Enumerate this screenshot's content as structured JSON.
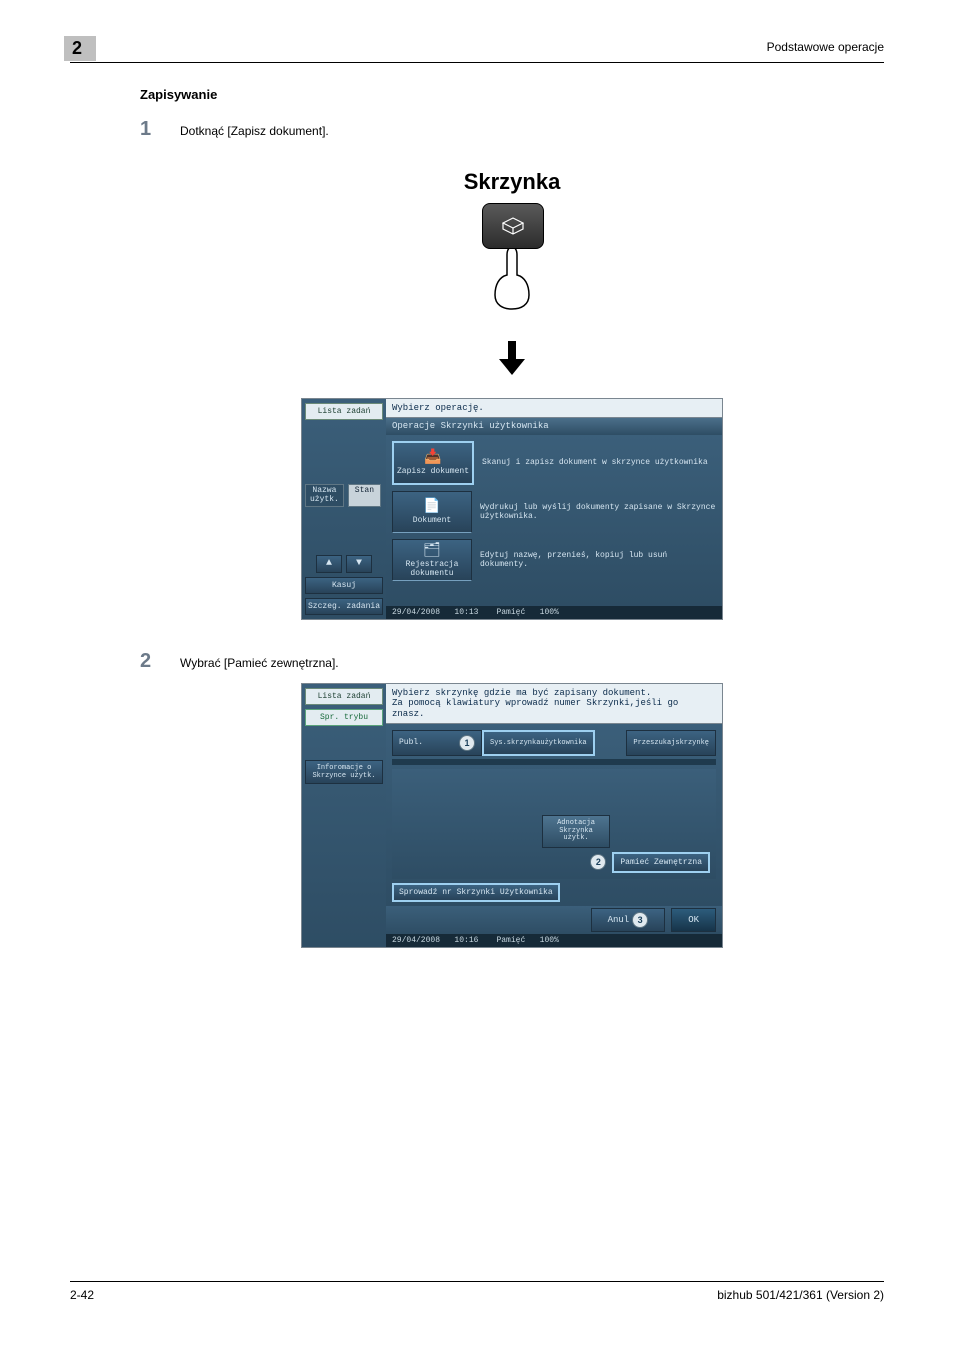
{
  "header": {
    "chapter": "2",
    "right": "Podstawowe operacje"
  },
  "section_title": "Zapisywanie",
  "step1": {
    "num": "1",
    "text": "Dotknąć [Zapisz dokument]."
  },
  "big_title": "Skrzynka",
  "screen1": {
    "side": {
      "list_tasks": "Lista zadań",
      "tab_name": "Nazwa użytk.",
      "tab_status": "Stan",
      "delete": "Kasuj",
      "details": "Szczeg. zadania"
    },
    "top": "Wybierz operację.",
    "section": "Operacje Skrzynki użytkownika",
    "ops": [
      {
        "label": "Zapisz dokument",
        "desc": "Skanuj i zapisz dokument w skrzynce użytkownika"
      },
      {
        "label": "Dokument",
        "desc": "Wydrukuj lub wyślij dokumenty zapisane w Skrzynce użytkownika."
      },
      {
        "label": "Rejestracja dokumentu",
        "desc": "Edytuj nazwę, przenieś, kopiuj lub usuń dokumenty."
      }
    ],
    "status": {
      "date": "29/04/2008",
      "time": "10:13",
      "mem_label": "Pamięć",
      "mem_val": "100%"
    }
  },
  "step2": {
    "num": "2",
    "text": "Wybrać [Pamieć zewnętrzna]."
  },
  "screen2": {
    "side": {
      "list_tasks": "Lista zadań",
      "mode": "Spr. trybu",
      "info": "Inforomacje o Skrzynce użytk."
    },
    "top": "Wybierz skrzynkę gdzie ma być zapisany dokument.\nZa pomocą klawiatury wprowadź numer Skrzynki,jeśli go znasz.",
    "tabs": {
      "publ": "Publ.",
      "sys": "Sys.skrzynkaużytkownika",
      "search": "Przeszukajskrzynkę"
    },
    "annot_box": "Adnotacja\nSkrzynka\nużytk.",
    "mem_btn": "Pamieć Zewnętrzna",
    "scan_btn": "Sprowadź nr Skrzynki Użytkownika",
    "cancel": "Anul",
    "ok": "OK",
    "status": {
      "date": "29/04/2008",
      "time": "10:16",
      "mem_label": "Pamięć",
      "mem_val": "100%"
    },
    "callouts": {
      "c1": "1",
      "c2": "2",
      "c3": "3"
    }
  },
  "footer": {
    "left": "2-42",
    "right": "bizhub 501/421/361 (Version 2)"
  }
}
